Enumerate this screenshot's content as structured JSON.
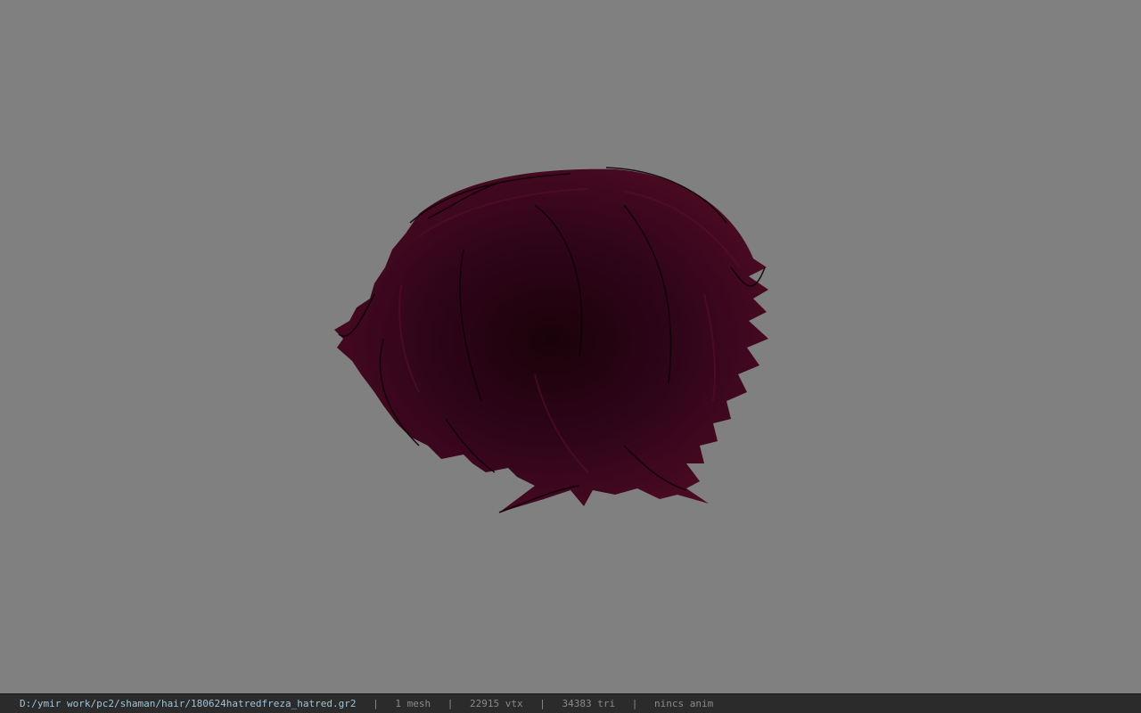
{
  "viewer": {
    "background_color": "#808080",
    "model": {
      "name": "hair-mesh",
      "color": "#3a0618"
    }
  },
  "statusbar": {
    "file_path": "D:/ymir work/pc2/shaman/hair/180624hatredfreza_hatred.gr2",
    "separator": "|",
    "mesh_count": "1 mesh",
    "vertex_count": "22915 vtx",
    "triangle_count": "34383 tri",
    "anim_status": "nincs anim"
  }
}
